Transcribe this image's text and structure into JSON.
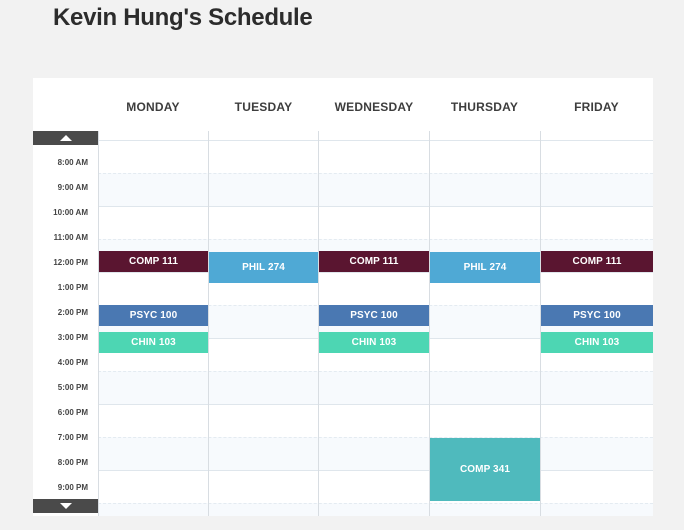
{
  "page": {
    "title": "Kevin Hung's Schedule"
  },
  "days": [
    "MONDAY",
    "TUESDAY",
    "WEDNESDAY",
    "THURSDAY",
    "FRIDAY"
  ],
  "times": [
    "8:00 AM",
    "9:00 AM",
    "10:00 AM",
    "11:00 AM",
    "12:00 PM",
    "1:00 PM",
    "2:00 PM",
    "3:00 PM",
    "4:00 PM",
    "5:00 PM",
    "6:00 PM",
    "7:00 PM",
    "8:00 PM",
    "9:00 PM"
  ],
  "colors": {
    "comp111": "#5a1530",
    "phil274": "#4fa9d5",
    "psyc100": "#4a78b2",
    "chin103": "#4dd6b3",
    "comp341": "#4fbabd"
  },
  "events": [
    {
      "label": "COMP 111",
      "day": "MONDAY",
      "start": "12:00 PM",
      "color_key": "comp111"
    },
    {
      "label": "PSYC 100",
      "day": "MONDAY",
      "start": "2:00 PM",
      "color_key": "psyc100"
    },
    {
      "label": "CHIN 103",
      "day": "MONDAY",
      "start": "3:00 PM",
      "color_key": "chin103"
    },
    {
      "label": "PHIL 274",
      "day": "TUESDAY",
      "start": "12:00 PM",
      "color_key": "phil274"
    },
    {
      "label": "COMP 111",
      "day": "WEDNESDAY",
      "start": "12:00 PM",
      "color_key": "comp111"
    },
    {
      "label": "PSYC 100",
      "day": "WEDNESDAY",
      "start": "2:00 PM",
      "color_key": "psyc100"
    },
    {
      "label": "CHIN 103",
      "day": "WEDNESDAY",
      "start": "3:00 PM",
      "color_key": "chin103"
    },
    {
      "label": "PHIL 274",
      "day": "THURSDAY",
      "start": "12:00 PM",
      "color_key": "phil274"
    },
    {
      "label": "COMP 341",
      "day": "THURSDAY",
      "start": "7:00 PM",
      "color_key": "comp341"
    },
    {
      "label": "COMP 111",
      "day": "FRIDAY",
      "start": "12:00 PM",
      "color_key": "comp111"
    },
    {
      "label": "PSYC 100",
      "day": "FRIDAY",
      "start": "2:00 PM",
      "color_key": "psyc100"
    },
    {
      "label": "CHIN 103",
      "day": "FRIDAY",
      "start": "3:00 PM",
      "color_key": "chin103"
    }
  ]
}
